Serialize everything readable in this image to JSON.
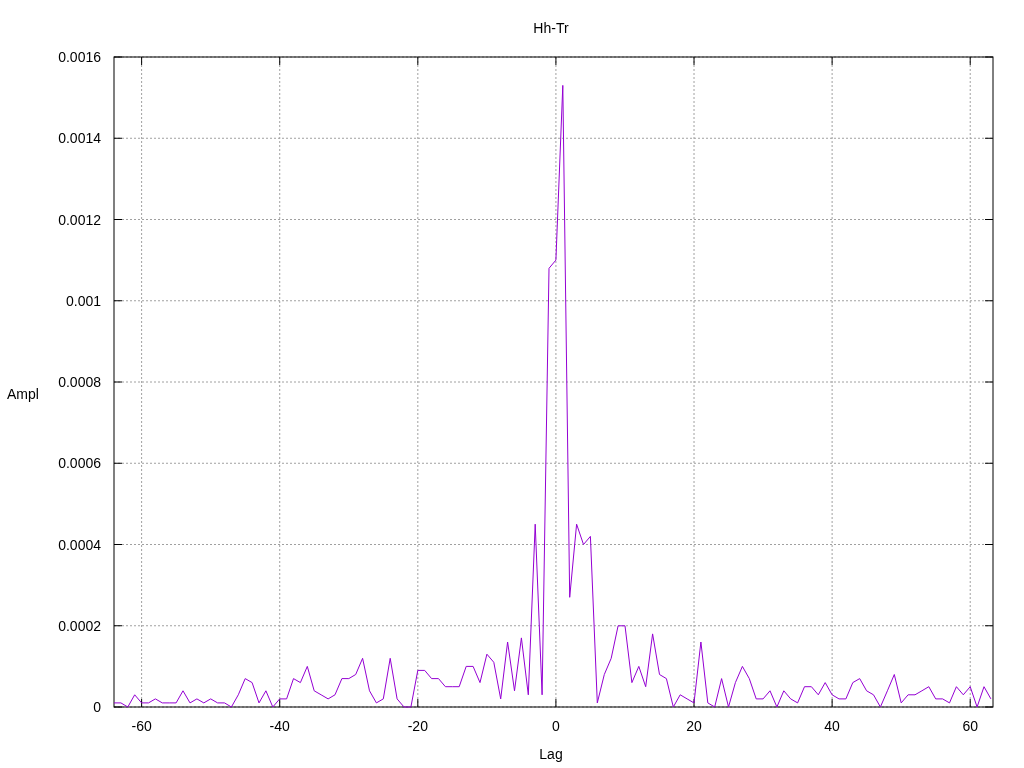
{
  "chart_data": {
    "type": "line",
    "title": "Hh-Tr",
    "xlabel": "Lag",
    "ylabel": "Ampl",
    "x": [
      -64,
      -63,
      -62,
      -61,
      -60,
      -59,
      -58,
      -57,
      -56,
      -55,
      -54,
      -53,
      -52,
      -51,
      -50,
      -49,
      -48,
      -47,
      -46,
      -45,
      -44,
      -43,
      -42,
      -41,
      -40,
      -39,
      -38,
      -37,
      -36,
      -35,
      -34,
      -33,
      -32,
      -31,
      -30,
      -29,
      -28,
      -27,
      -26,
      -25,
      -24,
      -23,
      -22,
      -21,
      -20,
      -19,
      -18,
      -17,
      -16,
      -15,
      -14,
      -13,
      -12,
      -11,
      -10,
      -9,
      -8,
      -7,
      -6,
      -5,
      -4,
      -3,
      -2,
      -1,
      0,
      1,
      2,
      3,
      4,
      5,
      6,
      7,
      8,
      9,
      10,
      11,
      12,
      13,
      14,
      15,
      16,
      17,
      18,
      19,
      20,
      21,
      22,
      23,
      24,
      25,
      26,
      27,
      28,
      29,
      30,
      31,
      32,
      33,
      34,
      35,
      36,
      37,
      38,
      39,
      40,
      41,
      42,
      43,
      44,
      45,
      46,
      47,
      48,
      49,
      50,
      51,
      52,
      53,
      54,
      55,
      56,
      57,
      58,
      59,
      60,
      61,
      62,
      63
    ],
    "values": [
      1e-05,
      1e-05,
      0,
      3e-05,
      1e-05,
      1e-05,
      2e-05,
      1e-05,
      1e-05,
      1e-05,
      4e-05,
      1e-05,
      2e-05,
      1e-05,
      2e-05,
      1e-05,
      1e-05,
      0,
      3e-05,
      7e-05,
      6e-05,
      1e-05,
      4e-05,
      0,
      2e-05,
      2e-05,
      7e-05,
      6e-05,
      0.0001,
      4e-05,
      3e-05,
      2e-05,
      3e-05,
      7e-05,
      7e-05,
      8e-05,
      0.00012,
      4e-05,
      1e-05,
      2e-05,
      0.00012,
      2e-05,
      0,
      0,
      9e-05,
      9e-05,
      7e-05,
      7e-05,
      5e-05,
      5e-05,
      5e-05,
      0.0001,
      0.0001,
      6e-05,
      0.00013,
      0.00011,
      2e-05,
      0.00016,
      4e-05,
      0.00017,
      3e-05,
      0.00045,
      3e-05,
      0.00108,
      0.0011,
      0.00153,
      0.00027,
      0.00045,
      0.0004,
      0.00042,
      1e-05,
      8e-05,
      0.00012,
      0.0002,
      0.0002,
      6e-05,
      0.0001,
      5e-05,
      0.00018,
      8e-05,
      7e-05,
      0,
      3e-05,
      2e-05,
      1e-05,
      0.00016,
      1e-05,
      0,
      7e-05,
      0,
      6e-05,
      0.0001,
      7e-05,
      2e-05,
      2e-05,
      4e-05,
      0,
      4e-05,
      2e-05,
      1e-05,
      5e-05,
      5e-05,
      3e-05,
      6e-05,
      3e-05,
      2e-05,
      2e-05,
      6e-05,
      7e-05,
      4e-05,
      3e-05,
      0,
      4e-05,
      8e-05,
      1e-05,
      3e-05,
      3e-05,
      4e-05,
      5e-05,
      2e-05,
      2e-05,
      1e-05,
      5e-05,
      3e-05,
      5e-05,
      0,
      5e-05,
      2e-05
    ],
    "grid": true,
    "xlim": [
      -64,
      63.3
    ],
    "ylim": [
      0,
      0.0016
    ],
    "xticks": [
      -60,
      -40,
      -20,
      0,
      20,
      40,
      60
    ],
    "yticks": [
      0,
      0.0002,
      0.0004,
      0.0006,
      0.0008,
      0.001,
      0.0012,
      0.0014,
      0.0016
    ]
  }
}
